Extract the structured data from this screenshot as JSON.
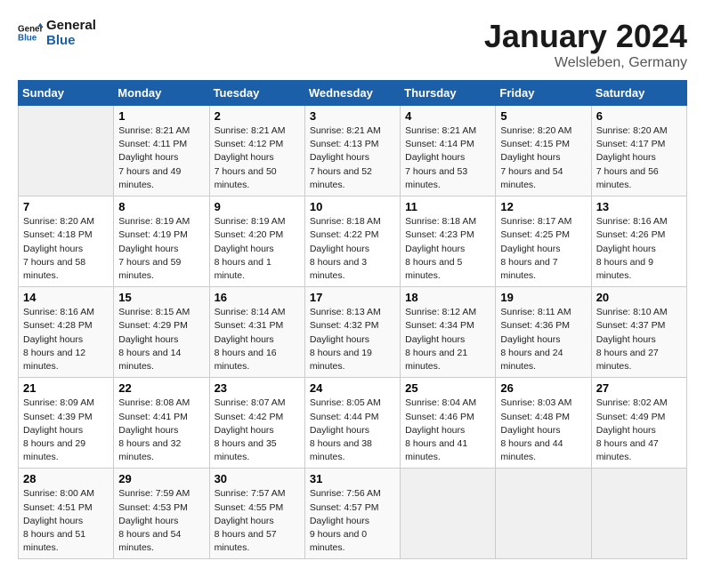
{
  "header": {
    "logo_general": "General",
    "logo_blue": "Blue",
    "month": "January 2024",
    "location": "Welsleben, Germany"
  },
  "days_of_week": [
    "Sunday",
    "Monday",
    "Tuesday",
    "Wednesday",
    "Thursday",
    "Friday",
    "Saturday"
  ],
  "weeks": [
    [
      {
        "day": "",
        "empty": true
      },
      {
        "day": "1",
        "sunrise": "8:21 AM",
        "sunset": "4:11 PM",
        "daylight": "7 hours and 49 minutes."
      },
      {
        "day": "2",
        "sunrise": "8:21 AM",
        "sunset": "4:12 PM",
        "daylight": "7 hours and 50 minutes."
      },
      {
        "day": "3",
        "sunrise": "8:21 AM",
        "sunset": "4:13 PM",
        "daylight": "7 hours and 52 minutes."
      },
      {
        "day": "4",
        "sunrise": "8:21 AM",
        "sunset": "4:14 PM",
        "daylight": "7 hours and 53 minutes."
      },
      {
        "day": "5",
        "sunrise": "8:20 AM",
        "sunset": "4:15 PM",
        "daylight": "7 hours and 54 minutes."
      },
      {
        "day": "6",
        "sunrise": "8:20 AM",
        "sunset": "4:17 PM",
        "daylight": "7 hours and 56 minutes."
      }
    ],
    [
      {
        "day": "7",
        "sunrise": "8:20 AM",
        "sunset": "4:18 PM",
        "daylight": "7 hours and 58 minutes."
      },
      {
        "day": "8",
        "sunrise": "8:19 AM",
        "sunset": "4:19 PM",
        "daylight": "7 hours and 59 minutes."
      },
      {
        "day": "9",
        "sunrise": "8:19 AM",
        "sunset": "4:20 PM",
        "daylight": "8 hours and 1 minute."
      },
      {
        "day": "10",
        "sunrise": "8:18 AM",
        "sunset": "4:22 PM",
        "daylight": "8 hours and 3 minutes."
      },
      {
        "day": "11",
        "sunrise": "8:18 AM",
        "sunset": "4:23 PM",
        "daylight": "8 hours and 5 minutes."
      },
      {
        "day": "12",
        "sunrise": "8:17 AM",
        "sunset": "4:25 PM",
        "daylight": "8 hours and 7 minutes."
      },
      {
        "day": "13",
        "sunrise": "8:16 AM",
        "sunset": "4:26 PM",
        "daylight": "8 hours and 9 minutes."
      }
    ],
    [
      {
        "day": "14",
        "sunrise": "8:16 AM",
        "sunset": "4:28 PM",
        "daylight": "8 hours and 12 minutes."
      },
      {
        "day": "15",
        "sunrise": "8:15 AM",
        "sunset": "4:29 PM",
        "daylight": "8 hours and 14 minutes."
      },
      {
        "day": "16",
        "sunrise": "8:14 AM",
        "sunset": "4:31 PM",
        "daylight": "8 hours and 16 minutes."
      },
      {
        "day": "17",
        "sunrise": "8:13 AM",
        "sunset": "4:32 PM",
        "daylight": "8 hours and 19 minutes."
      },
      {
        "day": "18",
        "sunrise": "8:12 AM",
        "sunset": "4:34 PM",
        "daylight": "8 hours and 21 minutes."
      },
      {
        "day": "19",
        "sunrise": "8:11 AM",
        "sunset": "4:36 PM",
        "daylight": "8 hours and 24 minutes."
      },
      {
        "day": "20",
        "sunrise": "8:10 AM",
        "sunset": "4:37 PM",
        "daylight": "8 hours and 27 minutes."
      }
    ],
    [
      {
        "day": "21",
        "sunrise": "8:09 AM",
        "sunset": "4:39 PM",
        "daylight": "8 hours and 29 minutes."
      },
      {
        "day": "22",
        "sunrise": "8:08 AM",
        "sunset": "4:41 PM",
        "daylight": "8 hours and 32 minutes."
      },
      {
        "day": "23",
        "sunrise": "8:07 AM",
        "sunset": "4:42 PM",
        "daylight": "8 hours and 35 minutes."
      },
      {
        "day": "24",
        "sunrise": "8:05 AM",
        "sunset": "4:44 PM",
        "daylight": "8 hours and 38 minutes."
      },
      {
        "day": "25",
        "sunrise": "8:04 AM",
        "sunset": "4:46 PM",
        "daylight": "8 hours and 41 minutes."
      },
      {
        "day": "26",
        "sunrise": "8:03 AM",
        "sunset": "4:48 PM",
        "daylight": "8 hours and 44 minutes."
      },
      {
        "day": "27",
        "sunrise": "8:02 AM",
        "sunset": "4:49 PM",
        "daylight": "8 hours and 47 minutes."
      }
    ],
    [
      {
        "day": "28",
        "sunrise": "8:00 AM",
        "sunset": "4:51 PM",
        "daylight": "8 hours and 51 minutes."
      },
      {
        "day": "29",
        "sunrise": "7:59 AM",
        "sunset": "4:53 PM",
        "daylight": "8 hours and 54 minutes."
      },
      {
        "day": "30",
        "sunrise": "7:57 AM",
        "sunset": "4:55 PM",
        "daylight": "8 hours and 57 minutes."
      },
      {
        "day": "31",
        "sunrise": "7:56 AM",
        "sunset": "4:57 PM",
        "daylight": "9 hours and 0 minutes."
      },
      {
        "day": "",
        "empty": true
      },
      {
        "day": "",
        "empty": true
      },
      {
        "day": "",
        "empty": true
      }
    ]
  ]
}
